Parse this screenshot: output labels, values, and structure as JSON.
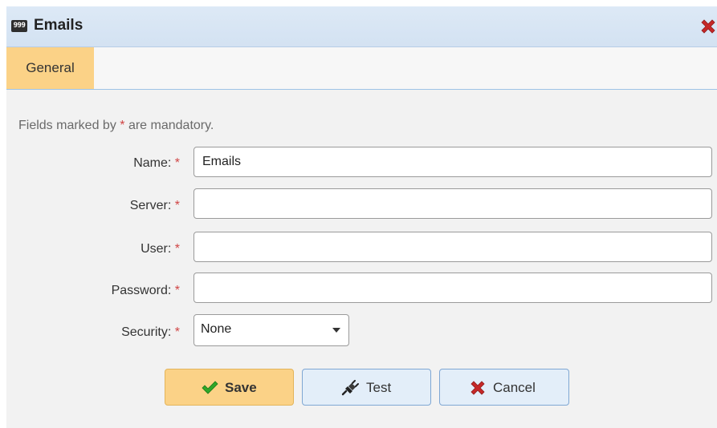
{
  "dialog": {
    "title": "Emails",
    "icon": "counter-icon",
    "icon_text": "999",
    "close_icon": "close-icon"
  },
  "tabs": [
    {
      "label": "General",
      "active": true
    }
  ],
  "form": {
    "note_prefix": "Fields marked by ",
    "note_asterisk": "*",
    "note_suffix": " are mandatory.",
    "fields": [
      {
        "label": "Name:",
        "required_mark": "*",
        "value": "Emails"
      },
      {
        "label": "Server:",
        "required_mark": "*",
        "value": ""
      },
      {
        "label": "User:",
        "required_mark": "*",
        "value": ""
      },
      {
        "label": "Password:",
        "required_mark": "*",
        "value": ""
      }
    ],
    "security": {
      "label": "Security:",
      "required_mark": "*",
      "value": "None"
    }
  },
  "buttons": {
    "save": {
      "label": "Save",
      "icon": "checkmark-icon"
    },
    "test": {
      "label": "Test",
      "icon": "plug-icon"
    },
    "cancel": {
      "label": "Cancel",
      "icon": "close-icon"
    }
  },
  "colors": {
    "title_bar": "#d6e4f3",
    "active_tab": "#fbd287",
    "required_asterisk": "#d04545",
    "save_check": "#2fa829",
    "cancel_x": "#c62828"
  }
}
